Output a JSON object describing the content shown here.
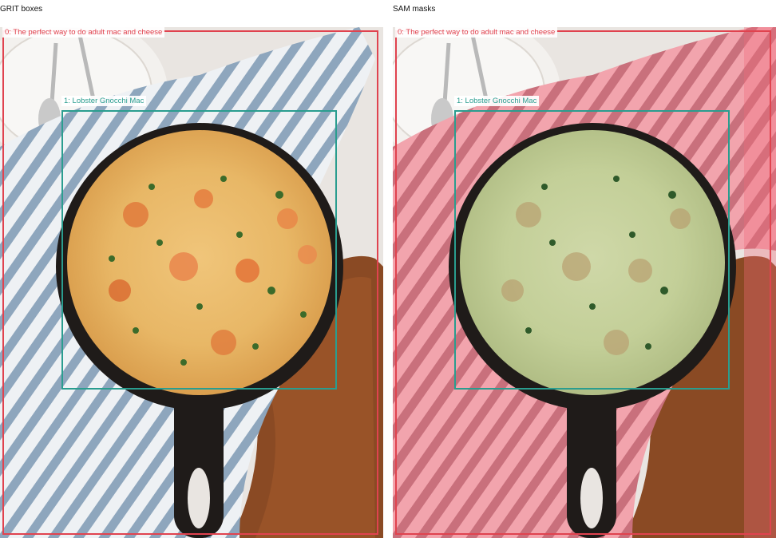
{
  "panels": [
    {
      "title": "GRIT boxes",
      "boxes": [
        {
          "label": "0: The perfect way to do adult mac and cheese",
          "color": "#e0434f"
        },
        {
          "label": "1: Lobster Gnocchi Mac",
          "color": "#2a9d8f"
        }
      ]
    },
    {
      "title": "SAM masks",
      "boxes": [
        {
          "label": "0: The perfect way to do adult mac and cheese",
          "color": "#e0434f"
        },
        {
          "label": "1: Lobster Gnocchi Mac",
          "color": "#2a9d8f"
        }
      ]
    }
  ],
  "colors": {
    "box_0": "#e0434f",
    "box_1": "#2a9d8f",
    "mask_0": "#f06b7a",
    "mask_1": "#8fd3c4"
  }
}
